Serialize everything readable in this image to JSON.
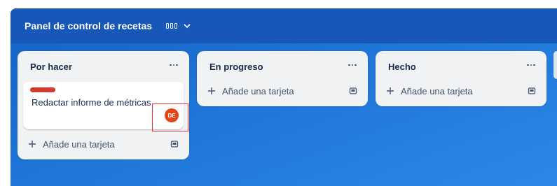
{
  "board": {
    "title": "Panel de control de recetas",
    "view_switcher_icon": "board-view-icon"
  },
  "lists": [
    {
      "title": "Por hacer",
      "menu_icon": "more-icon",
      "cards": [
        {
          "label_color": "#d33a2c",
          "title": "Redactar informe de métricas",
          "member_initials": "DE",
          "member_color": "#e4461a"
        }
      ],
      "add_card_label": "Añade una tarjeta"
    },
    {
      "title": "En progreso",
      "menu_icon": "more-icon",
      "cards": [],
      "add_card_label": "Añade una tarjeta"
    },
    {
      "title": "Hecho",
      "menu_icon": "more-icon",
      "cards": [],
      "add_card_label": "Añade una tarjeta"
    }
  ],
  "colors": {
    "board_header": "#1657b8",
    "board_background": "#1f75d8",
    "list_background": "#f1f2f4"
  }
}
